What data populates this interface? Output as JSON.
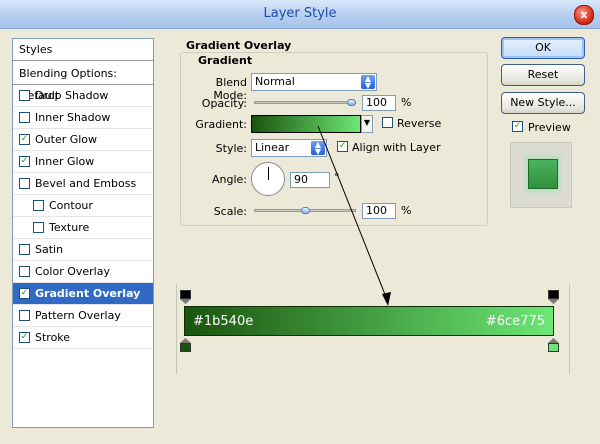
{
  "window": {
    "title": "Layer Style",
    "close_glyph": "x"
  },
  "styles_list": {
    "header": "Styles",
    "blending_options": "Blending Options: Default",
    "items": [
      {
        "label": "Drop Shadow",
        "checked": false,
        "indent": false
      },
      {
        "label": "Inner Shadow",
        "checked": false,
        "indent": false
      },
      {
        "label": "Outer Glow",
        "checked": true,
        "indent": false
      },
      {
        "label": "Inner Glow",
        "checked": true,
        "indent": false
      },
      {
        "label": "Bevel and Emboss",
        "checked": false,
        "indent": false
      },
      {
        "label": "Contour",
        "checked": false,
        "indent": true
      },
      {
        "label": "Texture",
        "checked": false,
        "indent": true
      },
      {
        "label": "Satin",
        "checked": false,
        "indent": false
      },
      {
        "label": "Color Overlay",
        "checked": false,
        "indent": false
      },
      {
        "label": "Gradient Overlay",
        "checked": true,
        "indent": false,
        "selected": true
      },
      {
        "label": "Pattern Overlay",
        "checked": false,
        "indent": false
      },
      {
        "label": "Stroke",
        "checked": true,
        "indent": false
      }
    ]
  },
  "panel": {
    "title": "Gradient Overlay",
    "subtitle": "Gradient",
    "blend_mode": {
      "label": "Blend Mode:",
      "value": "Normal"
    },
    "opacity": {
      "label": "Opacity:",
      "value": "100",
      "unit": "%",
      "level": 1.0
    },
    "gradient": {
      "label": "Gradient:",
      "reverse_label": "Reverse",
      "reverse_checked": false
    },
    "style": {
      "label": "Style:",
      "value": "Linear",
      "align_label": "Align with Layer",
      "align_checked": true
    },
    "angle": {
      "label": "Angle:",
      "value": "90",
      "unit": "°"
    },
    "scale": {
      "label": "Scale:",
      "value": "100",
      "unit": "%",
      "level": 0.5
    }
  },
  "buttons": {
    "ok": "OK",
    "reset": "Reset",
    "new_style": "New Style...",
    "preview_label": "Preview",
    "preview_checked": true
  },
  "gradient_editor": {
    "start_color": "#1b540e",
    "end_color": "#6ce775",
    "start_label": "#1b540e",
    "end_label": "#6ce775"
  },
  "colors": {
    "selection": "#316ac5",
    "gradient_start": "#1b540e",
    "gradient_end": "#6ce775"
  }
}
